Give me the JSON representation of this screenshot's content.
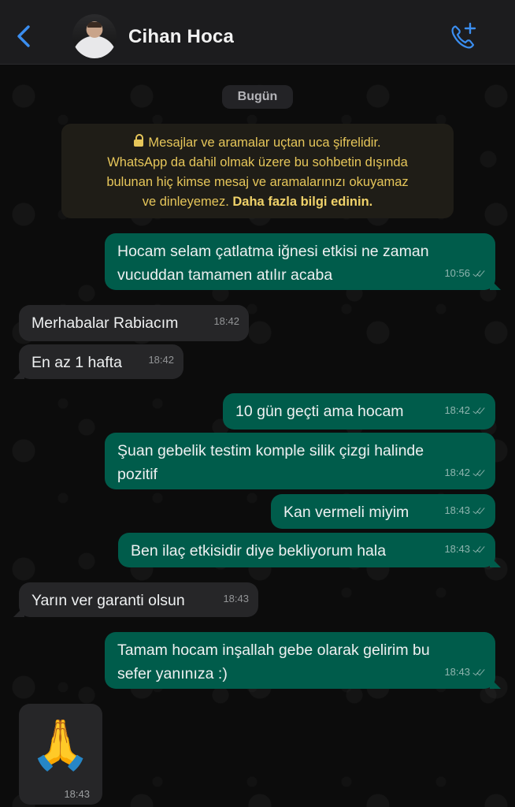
{
  "header": {
    "contact_name": "Cihan Hoca",
    "back_icon": "chevron-left-icon",
    "call_icon": "add-call-icon",
    "accent_color": "#3b8ef0"
  },
  "chat": {
    "date_label": "Bugün",
    "encryption": {
      "lines": [
        "Mesajlar ve aramalar uçtan uca şifrelidir.",
        "WhatsApp da dahil olmak üzere bu sohbetin dışında",
        "bulunan hiç kimse mesaj ve aramalarınızı okuyamaz",
        "ve dinleyemez."
      ],
      "learn_more": "Daha fazla bilgi edinin.",
      "color": "#e6c65a"
    },
    "messages": [
      {
        "dir": "out",
        "lines": [
          "Hocam selam çatlatma iğnesi etkisi ne zaman",
          "vucuddan tamamen atılır acaba"
        ],
        "time": "10:56"
      },
      {
        "dir": "in",
        "lines": [
          "Merhabalar Rabiacım"
        ],
        "time": "18:42"
      },
      {
        "dir": "in",
        "lines": [
          "En az 1 hafta"
        ],
        "time": "18:42"
      },
      {
        "dir": "out",
        "lines": [
          "10 gün geçti ama hocam"
        ],
        "time": "18:42"
      },
      {
        "dir": "out",
        "lines": [
          "Şuan gebelik testim komple silik çizgi halinde",
          "pozitif"
        ],
        "time": "18:42"
      },
      {
        "dir": "out",
        "lines": [
          "Kan vermeli miyim"
        ],
        "time": "18:43"
      },
      {
        "dir": "out",
        "lines": [
          "Ben ilaç etkisidir diye bekliyorum hala"
        ],
        "time": "18:43"
      },
      {
        "dir": "in",
        "lines": [
          "Yarın ver garanti olsun"
        ],
        "time": "18:43"
      },
      {
        "dir": "out",
        "lines": [
          "Tamam hocam inşallah gebe olarak gelirim bu",
          "sefer yanınıza :)"
        ],
        "time": "18:43"
      }
    ],
    "emoji_message": {
      "emoji": "🙏",
      "time": "18:43"
    },
    "colors": {
      "outgoing_bubble": "#005c4b",
      "incoming_bubble": "#262628"
    }
  }
}
